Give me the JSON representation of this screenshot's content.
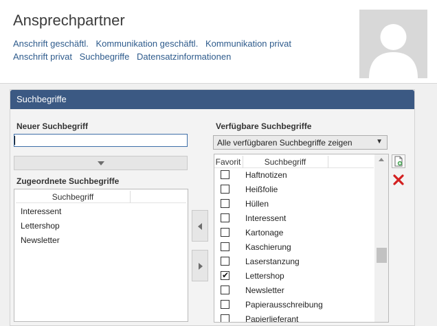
{
  "header": {
    "title": "Ansprechpartner",
    "links": [
      "Anschrift geschäftl.",
      "Kommunikation geschäftl.",
      "Kommunikation privat",
      "Anschrift privat",
      "Suchbegriffe",
      "Datensatzinformationen"
    ]
  },
  "panel": {
    "title": "Suchbegriffe",
    "new_label": "Neuer Suchbegriff",
    "new_value": "",
    "assigned_label": "Zugeordnete Suchbegriffe",
    "assigned_column": "Suchbegriff",
    "assigned_items": [
      "Interessent",
      "Lettershop",
      "Newsletter"
    ],
    "available_label": "Verfügbare Suchbegriffe",
    "filter_selected": "Alle verfügbaren Suchbegriffe zeigen",
    "available_columns": {
      "favorite": "Favorit",
      "term": "Suchbegriff"
    },
    "available_items": [
      {
        "name": "Haftnotizen",
        "checked": false
      },
      {
        "name": "Heißfolie",
        "checked": false
      },
      {
        "name": "Hüllen",
        "checked": false
      },
      {
        "name": "Interessent",
        "checked": false
      },
      {
        "name": "Kartonage",
        "checked": false
      },
      {
        "name": "Kaschierung",
        "checked": false
      },
      {
        "name": "Laserstanzung",
        "checked": false
      },
      {
        "name": "Lettershop",
        "checked": true
      },
      {
        "name": "Newsletter",
        "checked": false
      },
      {
        "name": "Papierausschreibung",
        "checked": false
      },
      {
        "name": "Papierlieferant",
        "checked": false
      }
    ]
  },
  "icons": {
    "tri_down": "chevron-down-icon",
    "add": "add-document-icon",
    "delete": "delete-icon"
  },
  "colors": {
    "panel_header": "#3b5983",
    "link": "#2e5b8c",
    "delete_red": "#d32020",
    "add_green": "#3fa34d"
  }
}
